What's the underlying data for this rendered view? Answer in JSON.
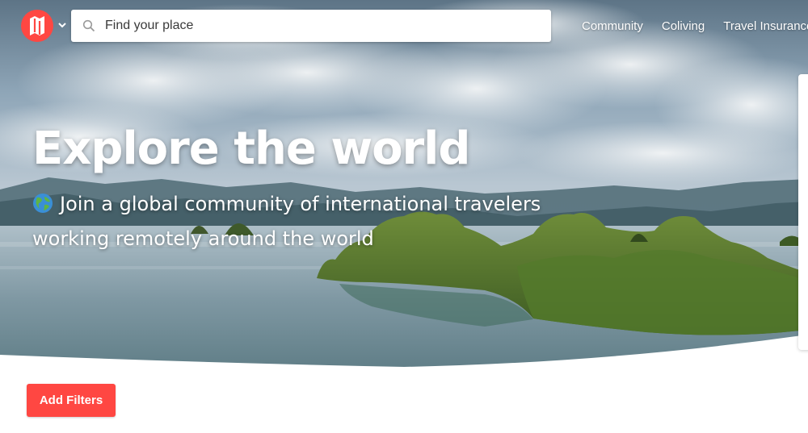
{
  "header": {
    "logo_icon": "map-logo-icon",
    "logo_color": "#ff4742",
    "dropdown_icon": "chevron-down-icon",
    "search": {
      "placeholder": "Find your place",
      "value": "",
      "icon": "search-icon"
    },
    "nav": [
      {
        "label": "Community"
      },
      {
        "label": "Coliving"
      },
      {
        "label": "Travel Insurance"
      }
    ]
  },
  "hero": {
    "title": "Explore the world",
    "subtitle_icon": "globe-icon",
    "subtitle": "Join a global community of international travelers working remotely around the world"
  },
  "filters": {
    "button_label": "Add Filters",
    "button_color": "#ff4742"
  }
}
